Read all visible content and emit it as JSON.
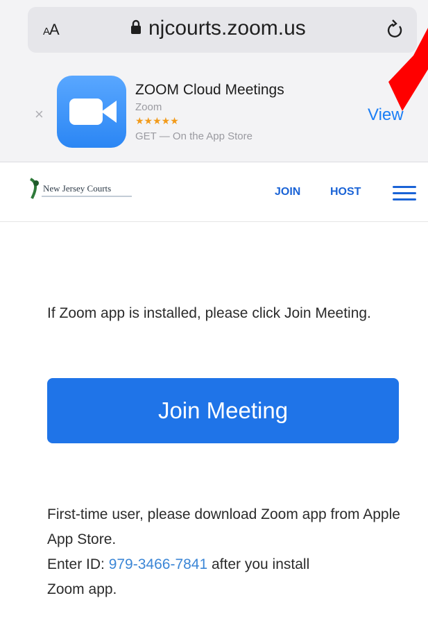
{
  "browser": {
    "text_size_label": "AA",
    "url": "njcourts.zoom.us",
    "icons": [
      "lock-icon",
      "reload-icon"
    ]
  },
  "app_banner": {
    "app_name": "ZOOM Cloud Meetings",
    "developer": "Zoom",
    "rating_stars": "★★★★★",
    "get_text": "GET — On the App Store",
    "view_label": "View",
    "close_label": "×",
    "icon_color": "#2b86f4"
  },
  "site_header": {
    "logo_text": "New Jersey Courts",
    "nav": {
      "join": "JOIN",
      "host": "HOST"
    },
    "accent": "#1a63d6"
  },
  "main": {
    "instruction": "If Zoom app is installed, please click Join Meeting.",
    "join_button": "Join Meeting",
    "first_time_text": "First-time user, please download Zoom app from Apple App Store.",
    "enter_id_prefix": "Enter ID: ",
    "meeting_id": "979-3466-7841",
    "enter_id_suffix": " after you install",
    "trailing_text": "Zoom app."
  },
  "annotation": {
    "color": "#ff0000"
  }
}
